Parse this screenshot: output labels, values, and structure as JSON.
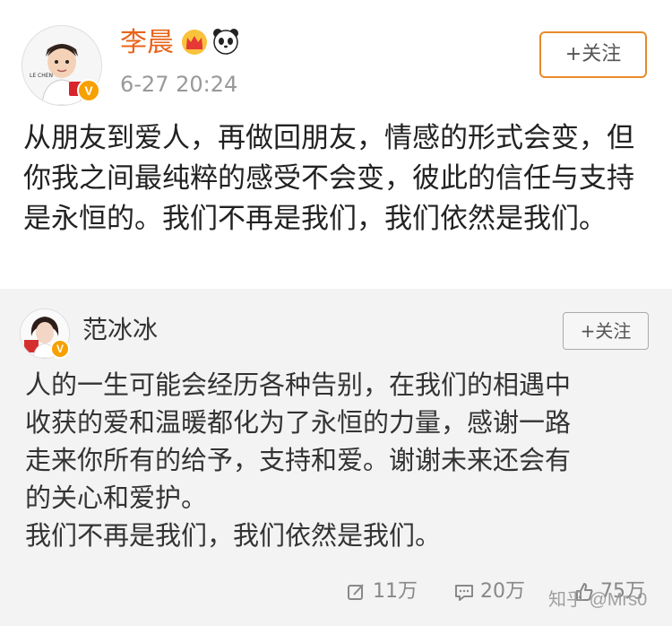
{
  "post": {
    "author": "李晨",
    "time": "6-27 20:24",
    "follow_label": "+关注",
    "avatar_caption": "LE CHEN",
    "verified_mark": "V",
    "content": "从朋友到爱人，再做回朋友，情感的形式会变，但你我之间最纯粹的感受不会变，彼此的信任与支持是永恒的。我们不再是我们，我们依然是我们。"
  },
  "repost": {
    "author": "范冰冰",
    "follow_label": "+关注",
    "verified_mark": "V",
    "content_lines": [
      "人的一生可能会经历各种告别，在我们的相遇中",
      "收获的爱和温暖都化为了永恒的力量，感谢一路",
      "走来你所有的给予，支持和爱。谢谢未来还会有",
      "的关心和爱护。",
      "我们不再是我们，我们依然是我们。"
    ],
    "actions": {
      "repost_count": "11万",
      "comment_count": "20万",
      "like_count": "75万"
    }
  },
  "watermark": "知乎 @Mrs0",
  "colors": {
    "author_name": "#e8641b",
    "follow_border": "#e88a2a",
    "repost_bg": "#f3f3f3",
    "verified_badge": "#f7a000"
  }
}
